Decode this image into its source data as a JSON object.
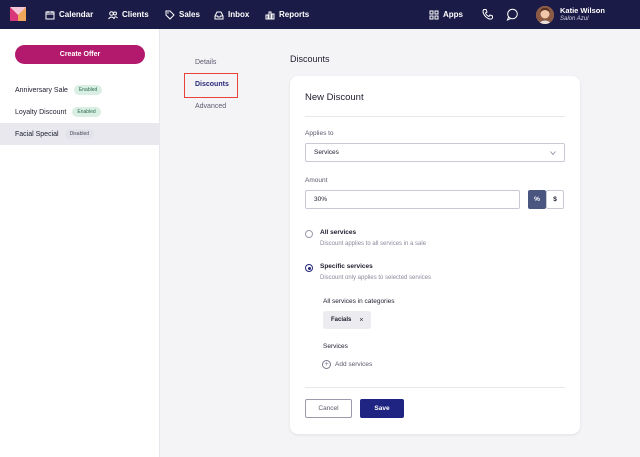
{
  "topnav": {
    "items": [
      {
        "label": "Calendar",
        "icon": "calendar-icon"
      },
      {
        "label": "Clients",
        "icon": "clients-icon"
      },
      {
        "label": "Sales",
        "icon": "tag-icon"
      },
      {
        "label": "Inbox",
        "icon": "inbox-icon"
      },
      {
        "label": "Reports",
        "icon": "reports-icon"
      }
    ],
    "apps_label": "Apps",
    "user": {
      "name": "Katie Wilson",
      "salon": "Salon Azul"
    }
  },
  "sidebar": {
    "create_label": "Create Offer",
    "offers": [
      {
        "name": "Anniversary Sale",
        "status": "Enabled"
      },
      {
        "name": "Loyalty Discount",
        "status": "Enabled"
      },
      {
        "name": "Facial Special",
        "status": "Disabled"
      }
    ]
  },
  "tabs": {
    "details": "Details",
    "discounts": "Discounts",
    "advanced": "Advanced"
  },
  "main": {
    "section_title": "Discounts",
    "card_title": "New Discount",
    "applies_to_label": "Applies to",
    "applies_to_value": "Services",
    "amount_label": "Amount",
    "amount_value": "30%",
    "unit_percent": "%",
    "unit_dollar": "$",
    "option_all_title": "All services",
    "option_all_desc": "Discount applies to all services in a sale",
    "option_specific_title": "Specific services",
    "option_specific_desc": "Discount only applies to selected services",
    "categories_label": "All services in categories",
    "category_chip": "Facials",
    "chip_remove": "×",
    "services_label": "Services",
    "add_services": "Add services",
    "cancel_label": "Cancel",
    "save_label": "Save"
  },
  "colors": {
    "nav_bg": "#1b1b47",
    "create_btn": "#b3196c",
    "save_btn": "#1f2381",
    "highlight_border": "#e8433a"
  }
}
